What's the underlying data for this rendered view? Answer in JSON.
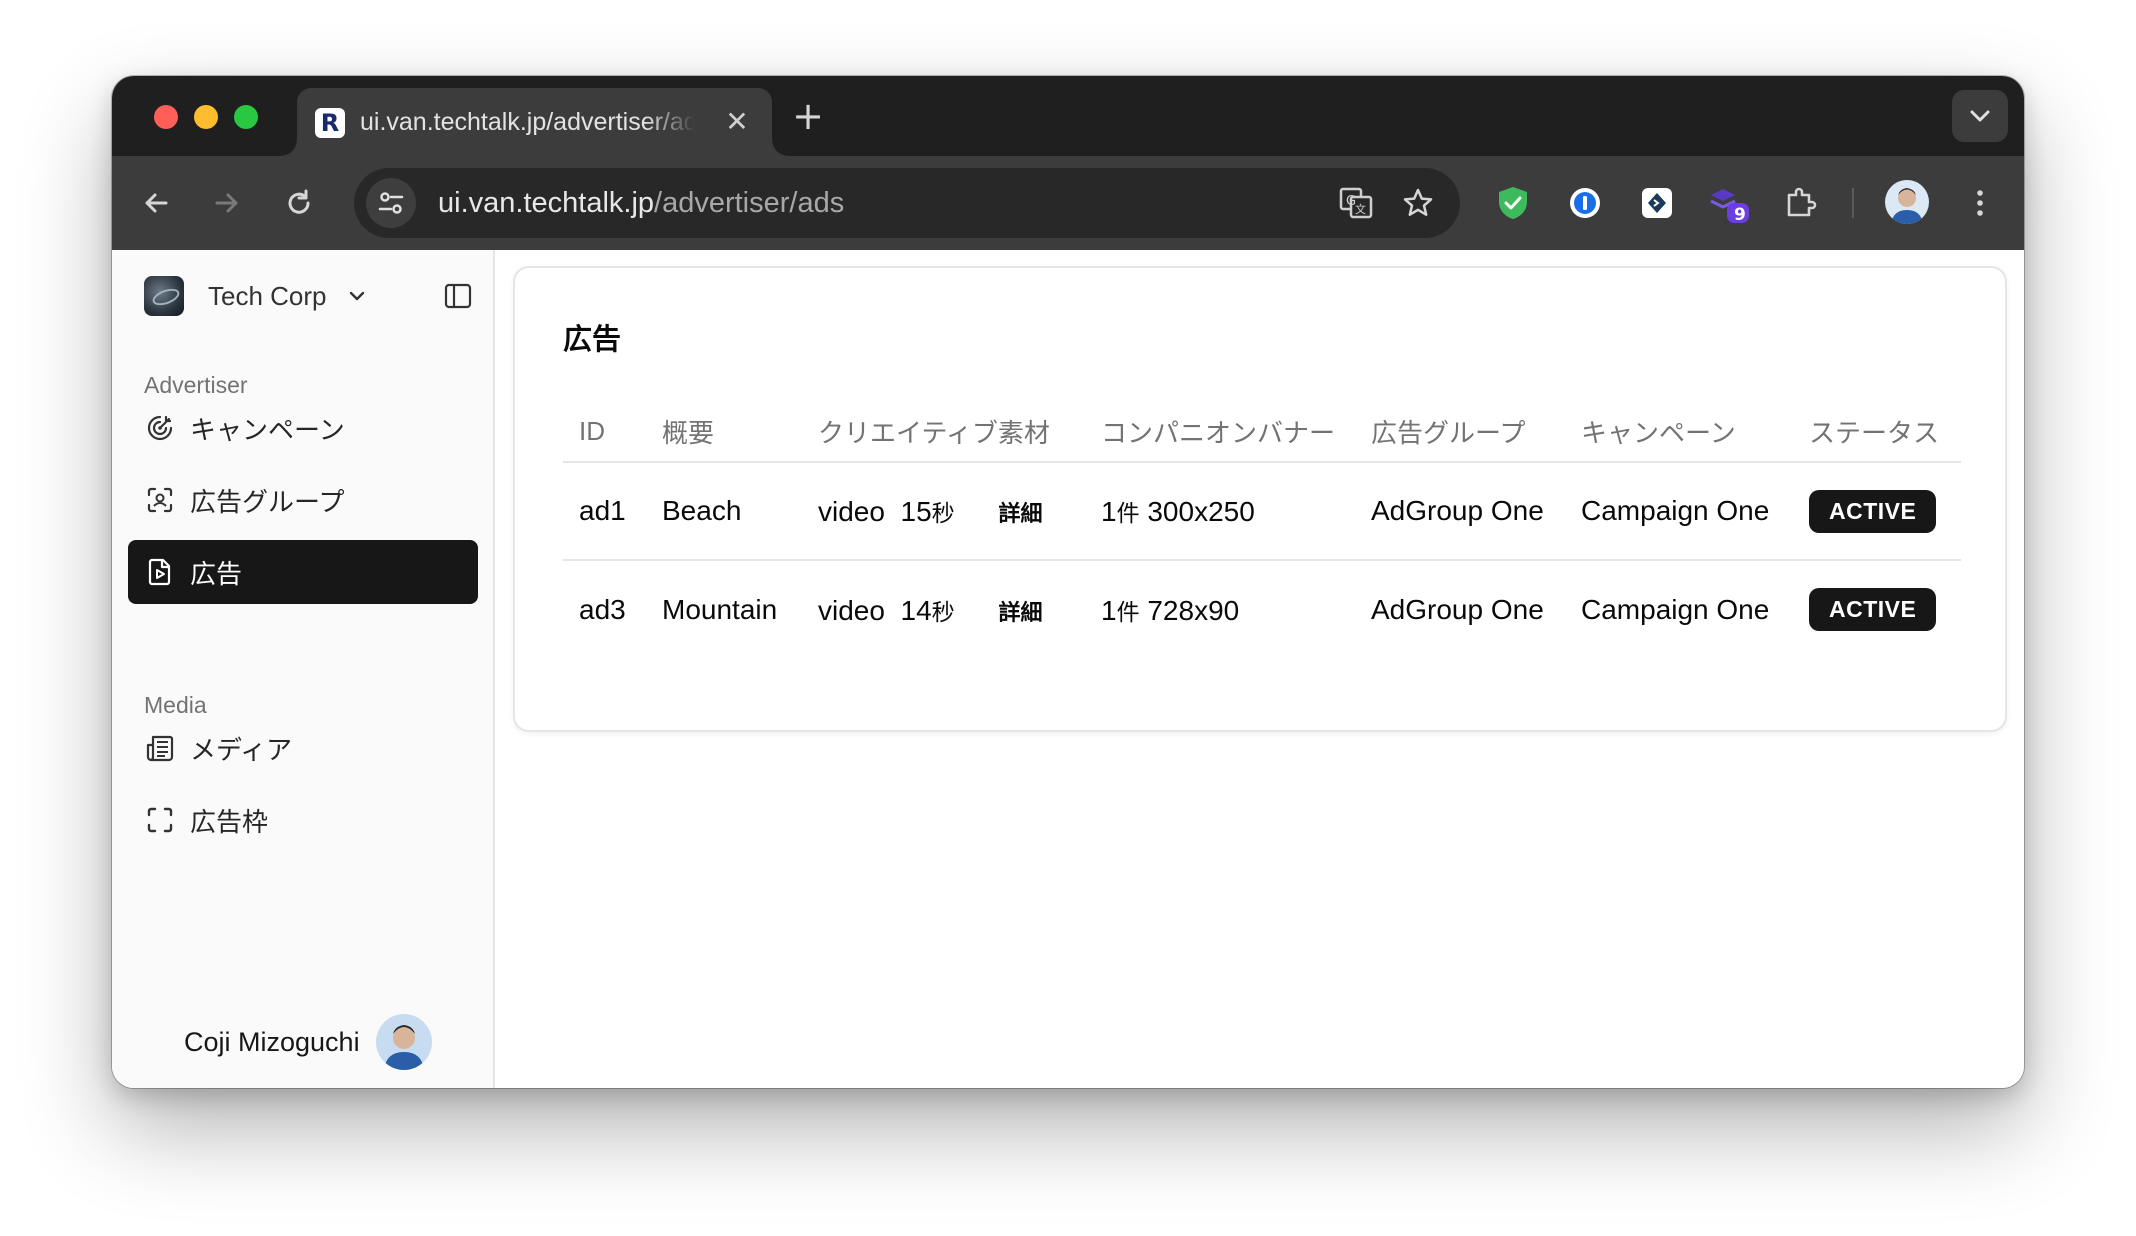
{
  "browser": {
    "tab_title": "ui.van.techtalk.jp/advertiser/ads",
    "tab_favicon": "R",
    "url_host": "ui.van.techtalk.jp",
    "url_path": "/advertiser/ads",
    "extension_badge": "9"
  },
  "sidebar": {
    "org_name": "Tech Corp",
    "groups": [
      {
        "label": "Advertiser",
        "items": [
          {
            "label": "キャンペーン",
            "icon": "campaign-icon"
          },
          {
            "label": "広告グループ",
            "icon": "scan-icon"
          },
          {
            "label": "広告",
            "icon": "file-play-icon",
            "active": true
          }
        ]
      },
      {
        "label": "Media",
        "items": [
          {
            "label": "メディア",
            "icon": "newspaper-icon"
          },
          {
            "label": "広告枠",
            "icon": "frame-icon"
          }
        ]
      }
    ],
    "user_name": "Coji Mizoguchi"
  },
  "main": {
    "title": "広告",
    "table": {
      "columns": [
        "ID",
        "概要",
        "クリエイティブ素材",
        "コンパニオンバナー",
        "広告グループ",
        "キャンペーン",
        "ステータス"
      ],
      "rows": [
        {
          "id": "ad1",
          "summary": "Beach",
          "creative_type": "video",
          "duration": "15",
          "duration_unit": "秒",
          "details": "詳細",
          "companion_count": "1",
          "companion_unit": "件",
          "companion_size": "300x250",
          "ad_group": "AdGroup One",
          "campaign": "Campaign One",
          "status": "ACTIVE"
        },
        {
          "id": "ad3",
          "summary": "Mountain",
          "creative_type": "video",
          "duration": "14",
          "duration_unit": "秒",
          "details": "詳細",
          "companion_count": "1",
          "companion_unit": "件",
          "companion_size": "728x90",
          "ad_group": "AdGroup One",
          "campaign": "Campaign One",
          "status": "ACTIVE"
        }
      ]
    }
  }
}
